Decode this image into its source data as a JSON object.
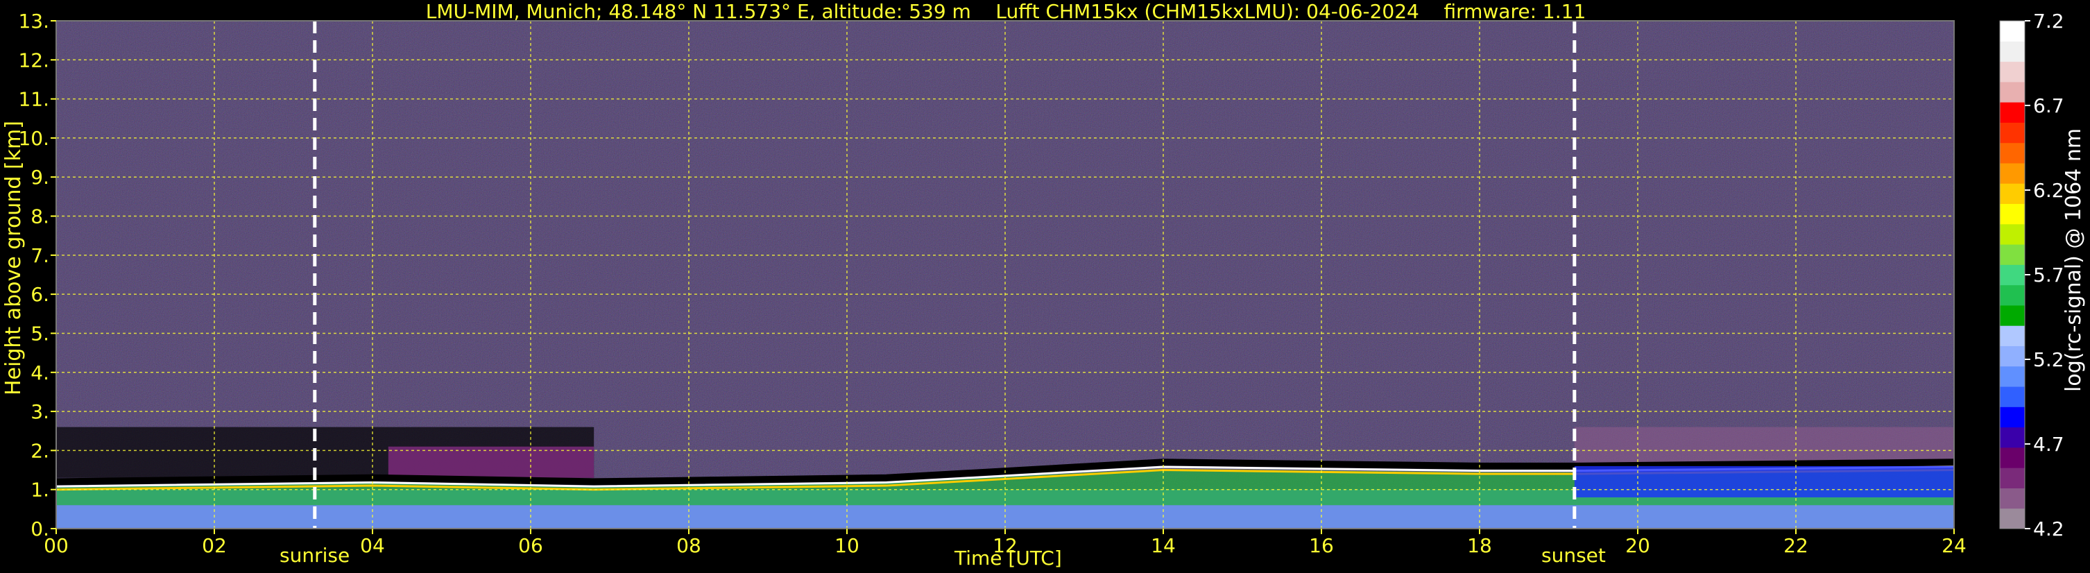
{
  "title": "LMU-MIM, Munich; 48.148° N 11.573° E, altitude: 539 m    Lufft CHM15kx (CHM15kxLMU): 04-06-2024    firmware: 1.11",
  "colors": {
    "background": "#000000",
    "text": "#ffff33",
    "grid": "#ffff33",
    "marker": "#ffffff"
  },
  "chart_data": {
    "type": "heatmap",
    "title": "LMU-MIM, Munich; 48.148° N 11.573° E, altitude: 539 m    Lufft CHM15kx (CHM15kxLMU): 04-06-2024    firmware: 1.11",
    "xlabel": "Time [UTC]",
    "ylabel": "Height above ground [km]",
    "xlim": [
      0,
      24
    ],
    "ylim": [
      0,
      13
    ],
    "x_ticks": [
      "00",
      "02",
      "04",
      "06",
      "08",
      "10",
      "12",
      "14",
      "16",
      "18",
      "20",
      "22",
      "24"
    ],
    "x_tick_values": [
      0,
      2,
      4,
      6,
      8,
      10,
      12,
      14,
      16,
      18,
      20,
      22,
      24
    ],
    "y_ticks": [
      "0.",
      "1.",
      "2.",
      "3.",
      "4.",
      "5.",
      "6.",
      "7.",
      "8.",
      "9.",
      "10.",
      "11.",
      "12.",
      "13."
    ],
    "y_tick_values": [
      0,
      1,
      2,
      3,
      4,
      5,
      6,
      7,
      8,
      9,
      10,
      11,
      12,
      13
    ],
    "grid": true,
    "colorbar": {
      "label": "log(rc-signal) @ 1064 nm",
      "range": [
        4.2,
        7.2
      ],
      "ticks": [
        "4.2",
        "4.7",
        "5.2",
        "5.7",
        "6.2",
        "6.7",
        "7.2"
      ],
      "tick_values": [
        4.2,
        4.7,
        5.2,
        5.7,
        6.2,
        6.7,
        7.2
      ],
      "colors": [
        "#9b8a9b",
        "#8a5a8a",
        "#7a2a7a",
        "#6a006a",
        "#3a00aa",
        "#0000ff",
        "#3060ff",
        "#6090ff",
        "#90b0ff",
        "#b0c8ff",
        "#00aa00",
        "#20c050",
        "#40d880",
        "#80e040",
        "#c0f000",
        "#ffff00",
        "#ffcc00",
        "#ff9900",
        "#ff6600",
        "#ff3300",
        "#ff0000",
        "#e8b0b0",
        "#f0d0d0",
        "#f0f0f0",
        "#ffffff"
      ]
    },
    "markers": [
      {
        "label": "sunrise",
        "x": 3.27
      },
      {
        "label": "sunset",
        "x": 19.2
      }
    ],
    "layers": [
      {
        "name": "noise background",
        "y_range": [
          2.5,
          13
        ],
        "x_range": [
          0,
          24
        ]
      },
      {
        "name": "boundary layer top",
        "approx_top_km": [
          [
            0,
            1.2
          ],
          [
            4,
            1.3
          ],
          [
            6.8,
            1.2
          ],
          [
            10.5,
            1.3
          ],
          [
            14,
            1.7
          ],
          [
            18,
            1.6
          ],
          [
            19.2,
            1.6
          ],
          [
            24,
            1.7
          ]
        ]
      },
      {
        "name": "residual layer",
        "x_range": [
          4.2,
          6.8
        ],
        "y_range": [
          1.4,
          2.1
        ]
      }
    ]
  }
}
